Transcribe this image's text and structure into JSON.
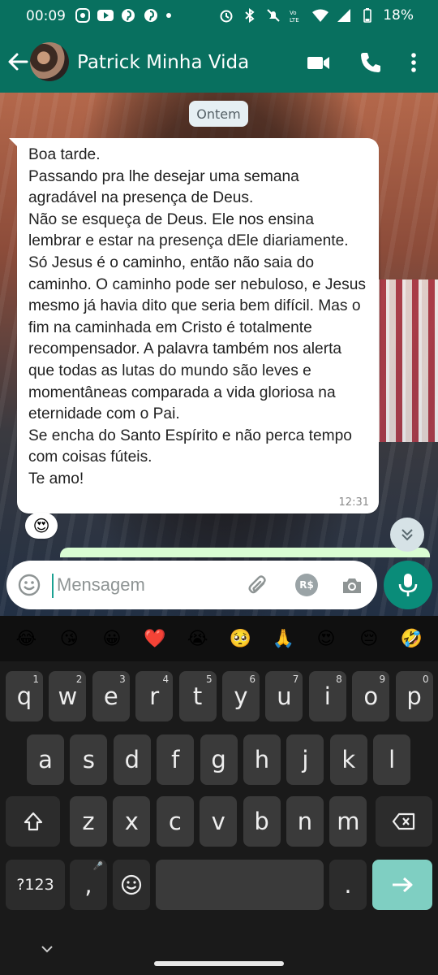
{
  "status_bar": {
    "time": "00:09",
    "battery": "18%",
    "network": "LTE"
  },
  "app_bar": {
    "contact_name": "Patrick Minha Vida"
  },
  "chat": {
    "date_chip": "Ontem",
    "message": {
      "text": "Boa tarde.\nPassando pra lhe desejar uma semana agradável na presença de Deus.\nNão se esqueça de Deus. Ele nos ensina lembrar e estar na presença dEle diariamente. Só Jesus é o caminho, então não saia do caminho. O caminho pode ser nebuloso, e Jesus mesmo já havia dito que seria bem difícil. Mas o fim na caminhada em Cristo é totalmente recompensador. A palavra também nos alerta que todas as lutas do mundo são leves e momentâneas comparada a vida gloriosa na eternidade com o Pai.\nSe encha do Santo Espírito e não perca tempo com coisas fúteis.\nTe amo!",
      "time": "12:31",
      "reaction": "😍"
    }
  },
  "composer": {
    "placeholder": "Mensagem",
    "pay_label": "R$"
  },
  "keyboard": {
    "emoji_suggestions": [
      "😂",
      "😘",
      "😀",
      "❤️",
      "😭",
      "🥺",
      "🙏",
      "😍",
      "😔",
      "🤣"
    ],
    "row1": [
      {
        "k": "q",
        "h": "1"
      },
      {
        "k": "w",
        "h": "2"
      },
      {
        "k": "e",
        "h": "3"
      },
      {
        "k": "r",
        "h": "4"
      },
      {
        "k": "t",
        "h": "5"
      },
      {
        "k": "y",
        "h": "6"
      },
      {
        "k": "u",
        "h": "7"
      },
      {
        "k": "i",
        "h": "8"
      },
      {
        "k": "o",
        "h": "9"
      },
      {
        "k": "p",
        "h": "0"
      }
    ],
    "row2": [
      "a",
      "s",
      "d",
      "f",
      "g",
      "h",
      "j",
      "k",
      "l"
    ],
    "row3": [
      "z",
      "x",
      "c",
      "v",
      "b",
      "n",
      "m"
    ],
    "symbols_label": "?123",
    "comma_label": ",",
    "period_label": "."
  },
  "colors": {
    "header": "#08705f",
    "accent": "#0a8c79",
    "bubble": "#ffffff",
    "key": "#3a3a3a",
    "send_key": "#7fcfc2"
  }
}
